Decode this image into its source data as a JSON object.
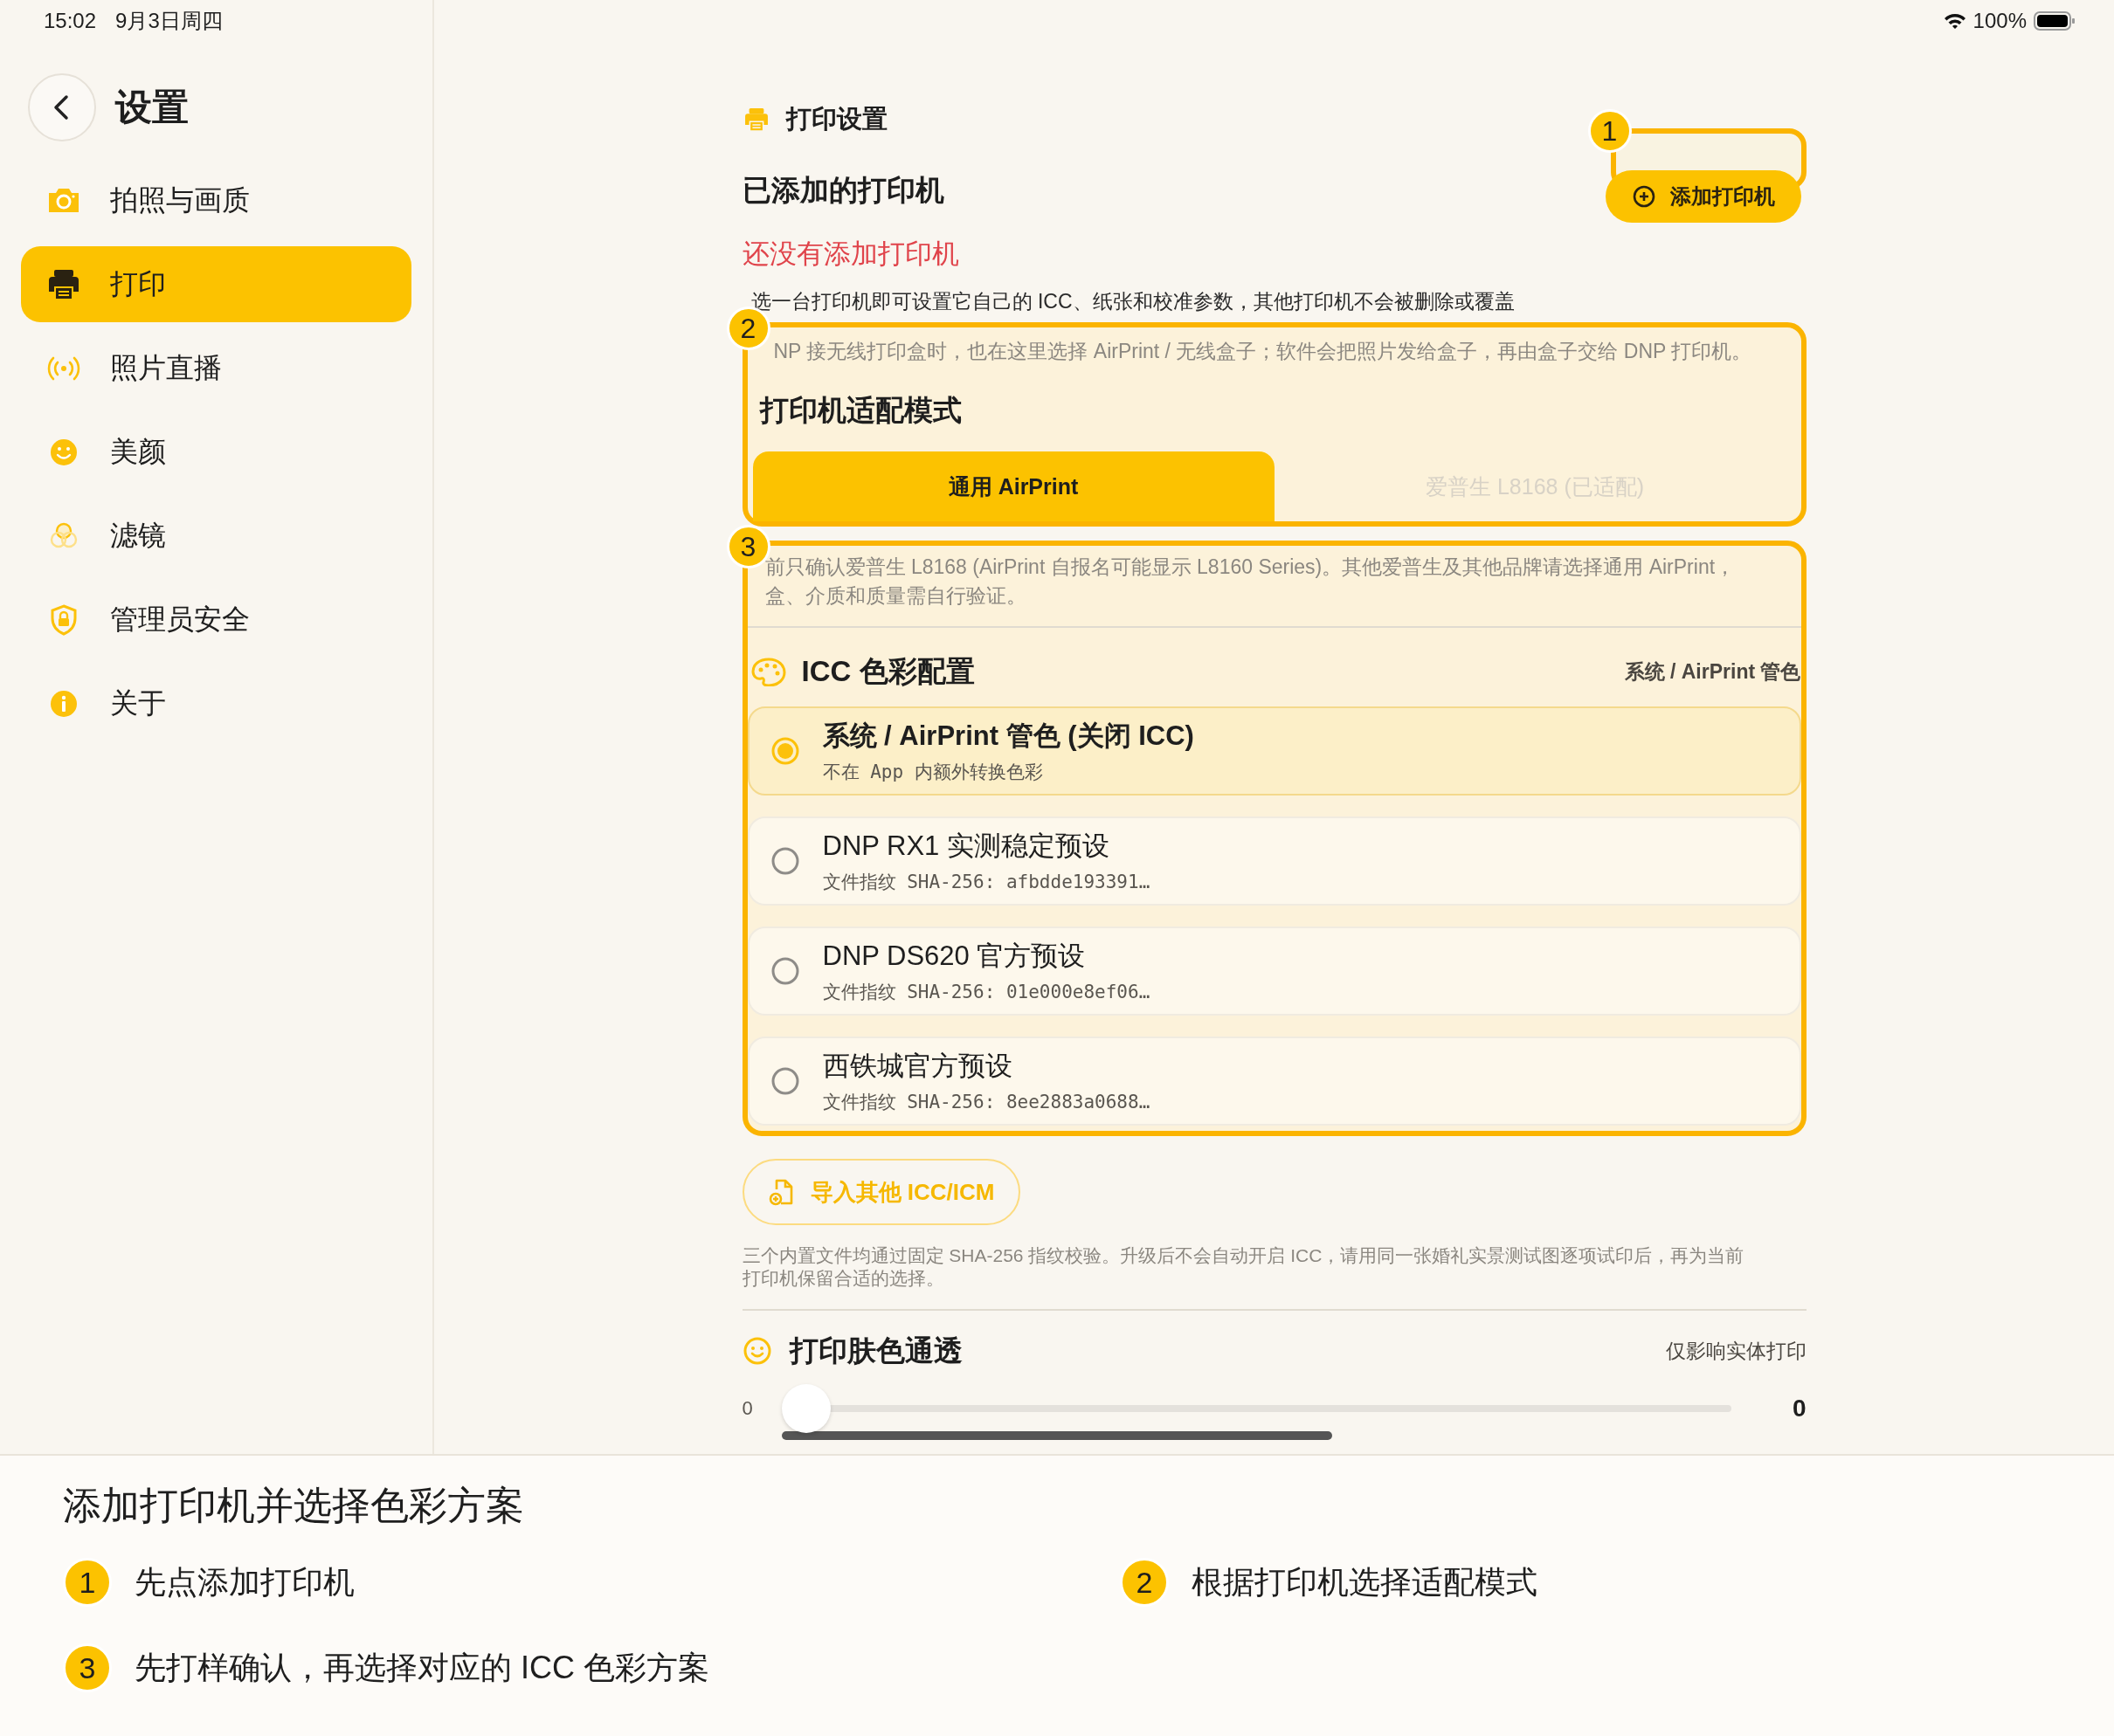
{
  "status_bar": {
    "time": "15:02",
    "date": "9月3日周四",
    "battery": "100%"
  },
  "sidebar": {
    "title": "设置",
    "items": [
      {
        "label": "拍照与画质",
        "selected": false
      },
      {
        "label": "打印",
        "selected": true
      },
      {
        "label": "照片直播",
        "selected": false
      },
      {
        "label": "美颜",
        "selected": false
      },
      {
        "label": "滤镜",
        "selected": false
      },
      {
        "label": "管理员安全",
        "selected": false
      },
      {
        "label": "关于",
        "selected": false
      }
    ]
  },
  "printers": {
    "section_title": "打印设置",
    "heading": "已添加的打印机",
    "empty_text": "还没有添加打印机",
    "add_button": "添加打印机",
    "hint": "选一台打印机即可设置它自己的 ICC、纸张和校准参数，其他打印机不会被删除或覆盖"
  },
  "mode": {
    "hint": "NP 接无线打印盒时，也在这里选择 AirPrint / 无线盒子；软件会把照片发给盒子，再由盒子交给 DNP 打印机。",
    "heading": "打印机适配模式",
    "options": [
      {
        "label": "通用 AirPrint",
        "selected": true
      },
      {
        "label": "爱普生 L8168 (已适配)",
        "selected": false
      }
    ]
  },
  "icc": {
    "note_lines": [
      "前只确认爱普生 L8168 (AirPrint 自报名可能显示 L8160 Series)。其他爱普生及其他品牌请选择通用 AirPrint，",
      "盒、介质和质量需自行验证。"
    ],
    "heading": "ICC 色彩配置",
    "current": "系统 / AirPrint 管色",
    "profiles": [
      {
        "name": "系统 / AirPrint 管色 (关闭 ICC)",
        "detail": "不在 App 内额外转换色彩",
        "selected": true
      },
      {
        "name": "DNP RX1 实测稳定预设",
        "detail": "文件指纹 SHA-256: afbdde193391…",
        "selected": false
      },
      {
        "name": "DNP DS620 官方预设",
        "detail": "文件指纹 SHA-256: 01e000e8ef06…",
        "selected": false
      },
      {
        "name": "西铁城官方预设",
        "detail": "文件指纹 SHA-256: 8ee2883a0688…",
        "selected": false
      }
    ],
    "import_button": "导入其他 ICC/ICM",
    "footnote_lines": [
      "三个内置文件均通过固定 SHA-256 指纹校验。升级后不会自动开启 ICC，请用同一张婚礼实景测试图逐项试印后，再为当前",
      "打印机保留合适的选择。"
    ]
  },
  "skin": {
    "heading": "打印肤色通透",
    "scope": "仅影响实体打印",
    "min_label": "0",
    "value": "0",
    "level": 0
  },
  "callouts": [
    {
      "number": "1"
    },
    {
      "number": "2"
    },
    {
      "number": "3"
    }
  ],
  "caption": {
    "title": "添加打印机并选择色彩方案",
    "steps": [
      {
        "number": "1",
        "text": "先点添加打印机"
      },
      {
        "number": "2",
        "text": "根据打印机选择适配模式"
      },
      {
        "number": "3",
        "text": "先打样确认，再选择对应的 ICC 色彩方案"
      }
    ]
  }
}
